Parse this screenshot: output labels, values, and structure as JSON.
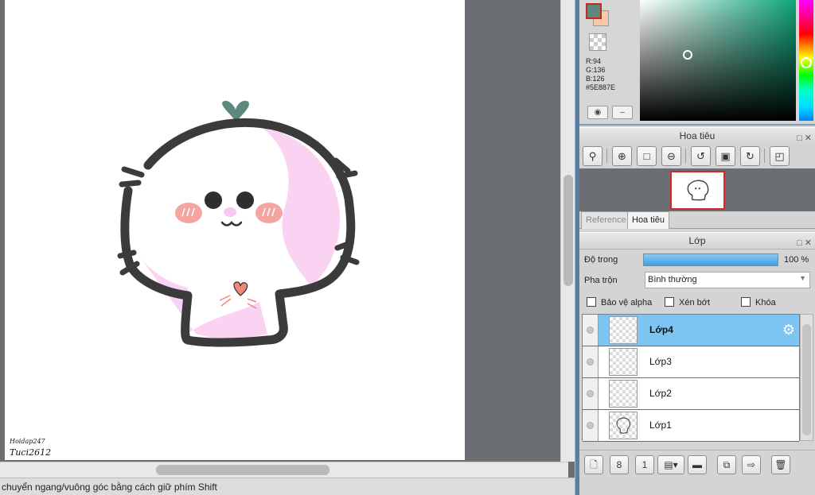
{
  "canvas": {
    "signature_line1": "Hoidap247",
    "signature_line2": "Tuci2612"
  },
  "status_bar": {
    "text": "chuyển ngang/vuông góc bằng cách giữ phím Shift"
  },
  "color_panel": {
    "main_color": "#5E887E",
    "sub_color": "#F9CAA8",
    "r": "R:94",
    "g": "G:136",
    "b": "B:126",
    "hex": "#5E887E",
    "buttons": [
      "palette-icon",
      "minimize-icon"
    ]
  },
  "navigator": {
    "title": "Hoa tiêu",
    "toolbar_icons": [
      "zoom-1-icon",
      "zoom-in-icon",
      "fit-icon",
      "zoom-out-icon",
      "rotate-left-icon",
      "fit-window-icon",
      "rotate-right-icon",
      "flip-icon"
    ],
    "tabs": [
      "Reference",
      "Hoa tiêu"
    ]
  },
  "layers_panel": {
    "title": "Lớp",
    "opacity_label": "Độ trong",
    "opacity_value": "100 %",
    "opacity_fraction": 1.0,
    "blend_label": "Pha trộn",
    "blend_value": "Bình thường",
    "checkboxes": [
      {
        "label": "Bảo vệ alpha",
        "checked": false
      },
      {
        "label": "Xén bớt",
        "checked": false
      },
      {
        "label": "Khóa",
        "checked": false
      }
    ],
    "layers": [
      {
        "name": "Lớp4",
        "selected": true
      },
      {
        "name": "Lớp3",
        "selected": false
      },
      {
        "name": "Lớp2",
        "selected": false
      },
      {
        "name": "Lớp1",
        "selected": false
      }
    ],
    "toolbar_icons": [
      "new-layer-icon",
      "new-layer-8bit-icon",
      "new-layer-1bit-icon",
      "halftone-icon",
      "folder-icon",
      "duplicate-icon",
      "merge-icon",
      "delete-icon"
    ]
  },
  "accent": {
    "selection": "#7DC4F2",
    "panel_border": "#5A7FA0",
    "preview_frame": "#D3282A"
  }
}
